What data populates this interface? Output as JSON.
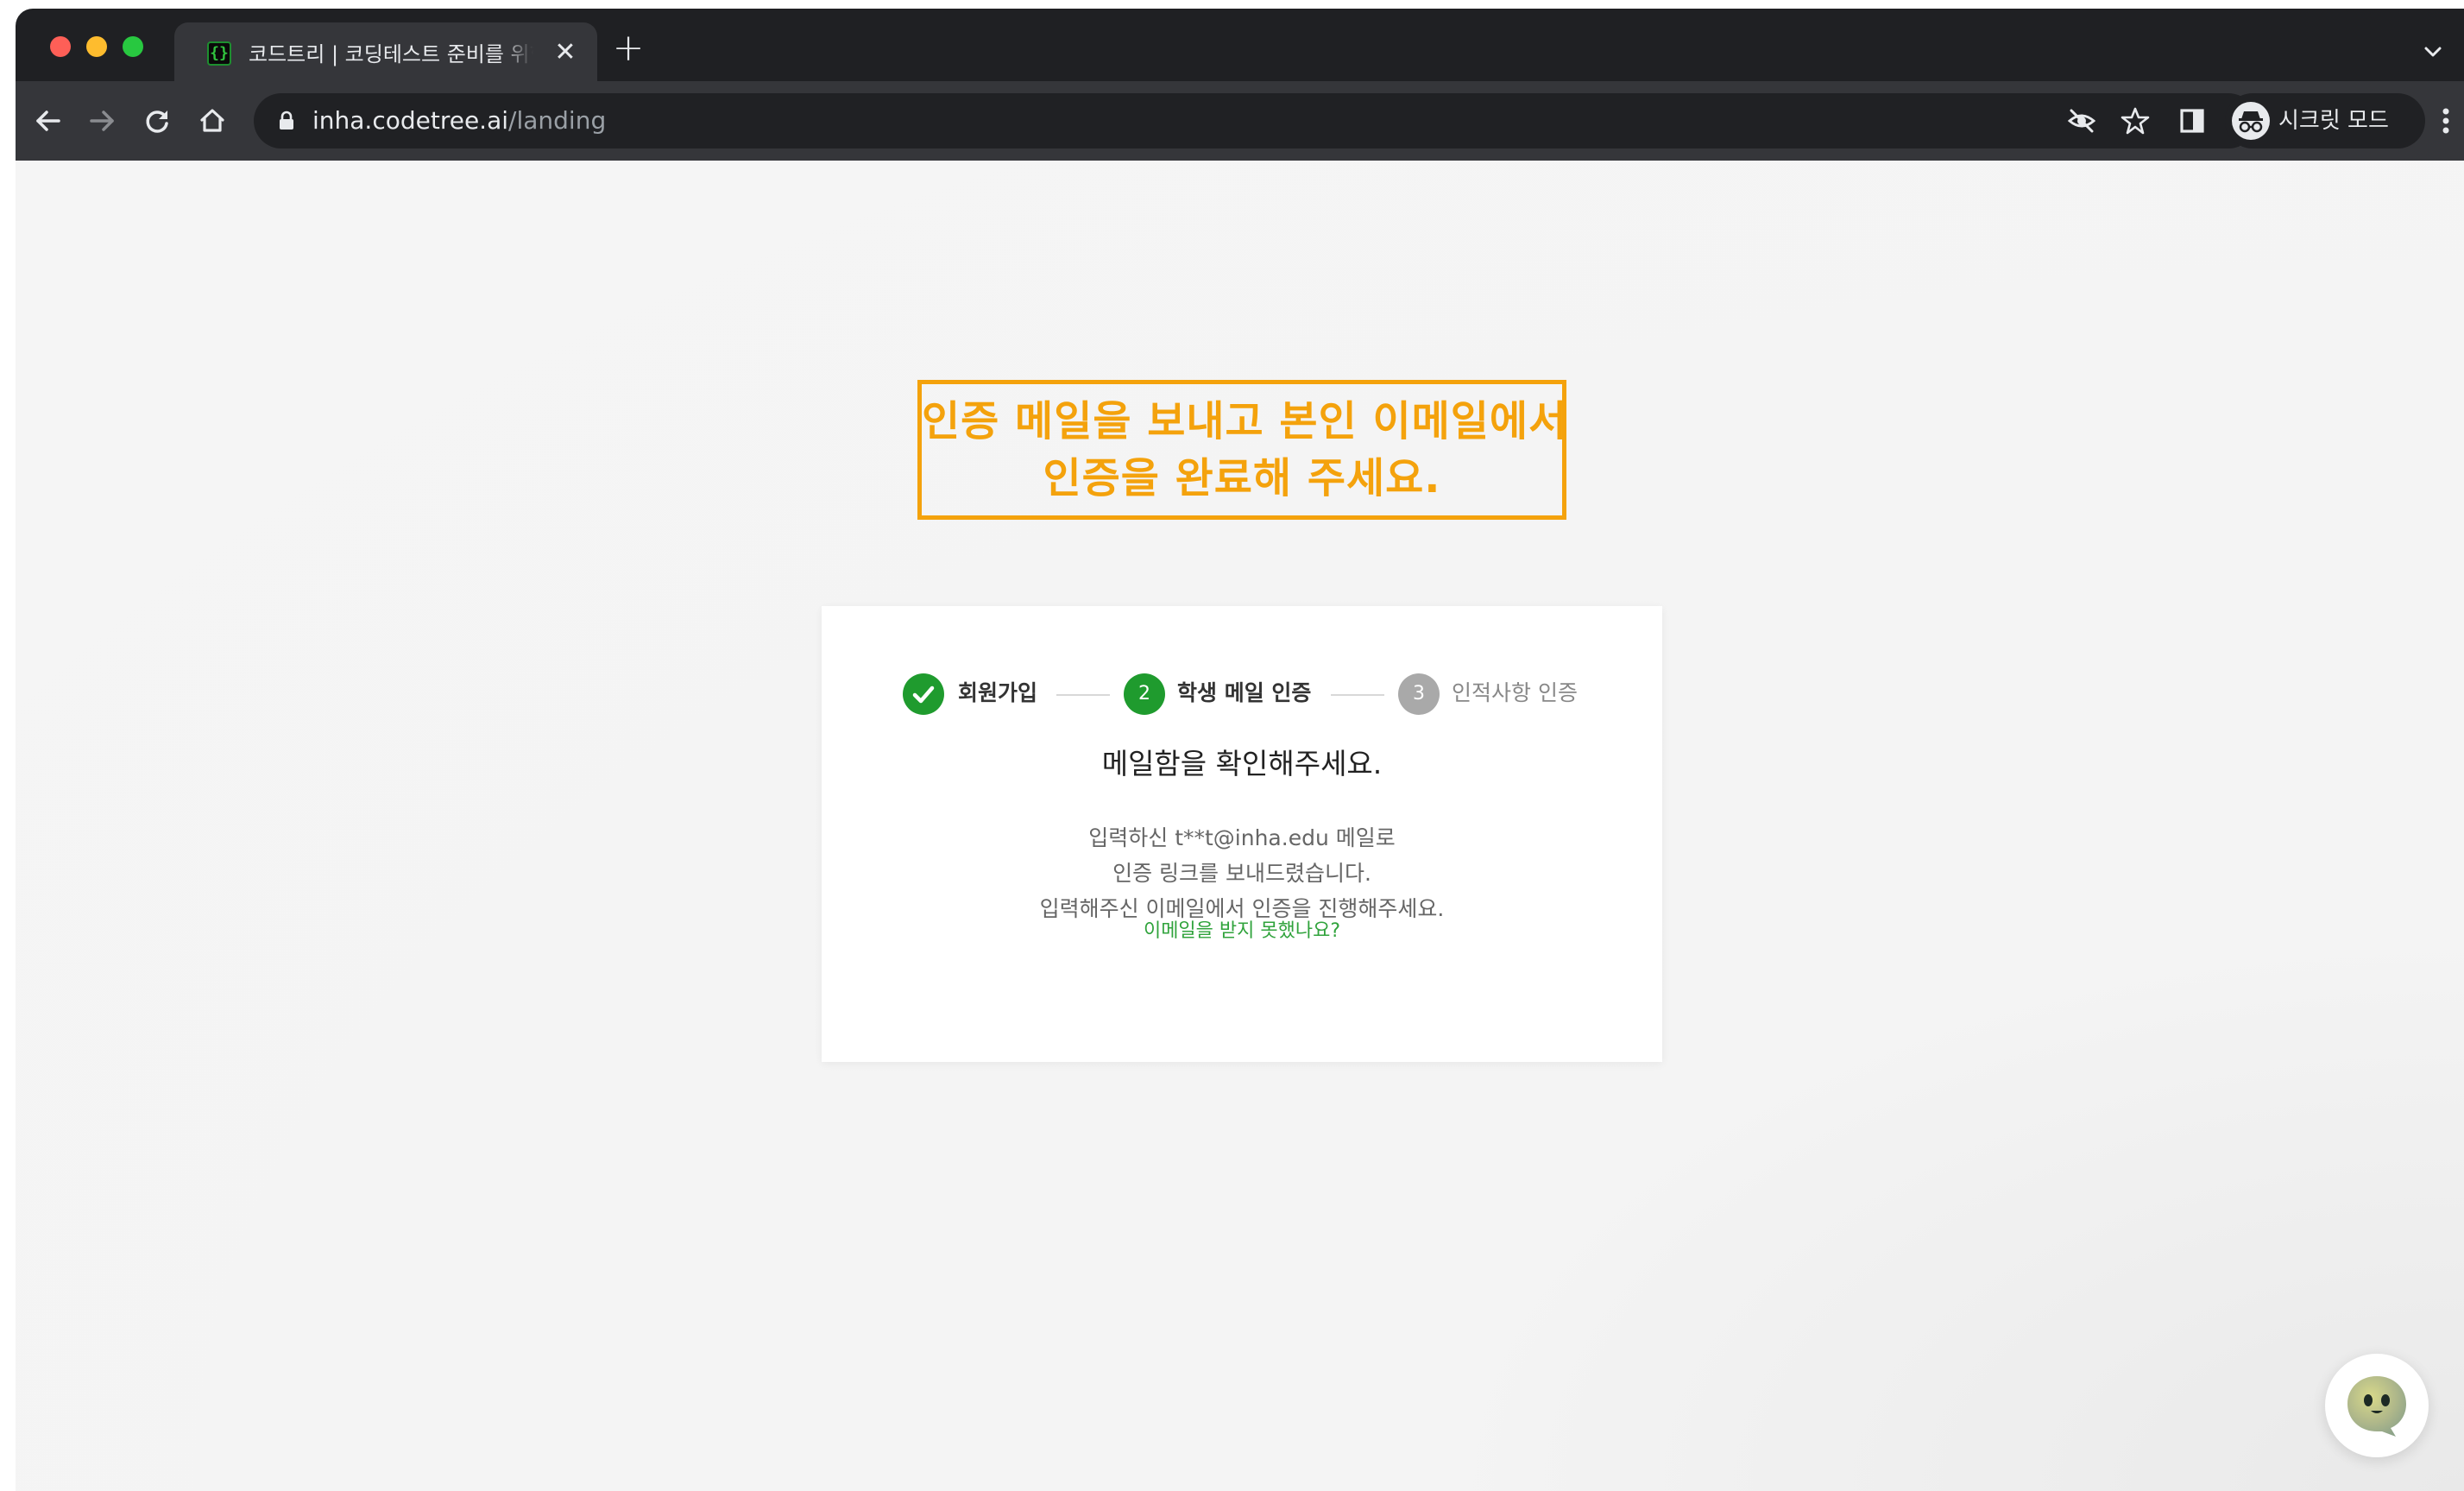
{
  "browser": {
    "tab_title": "코드트리 | 코딩테스트 준비를 위한 알고리즘",
    "tab_close": "✕",
    "new_tab": "+",
    "url_host": "inha.codetree.ai",
    "url_path": "/landing",
    "profile_label": "시크릿 모드"
  },
  "annotation": {
    "line1": "인증 메일을 보내고 본인 이메일에서",
    "line2": "인증을 완료해 주세요.",
    "color": "#f4a20c"
  },
  "stepper": {
    "steps": [
      {
        "label": "회원가입",
        "status": "done"
      },
      {
        "number": "2",
        "label": "학생 메일 인증",
        "status": "active"
      },
      {
        "number": "3",
        "label": "인적사항 인증",
        "status": "pending"
      }
    ]
  },
  "card": {
    "title": "메일함을 확인해주세요.",
    "body_line1": "입력하신 t**t@inha.edu 메일로",
    "body_line2": "인증 링크를 보내드렸습니다.",
    "body_line3": "입력해주신 이메일에서 인증을 진행해주세요.",
    "resend_link": "이메일을 받지 못했나요?"
  },
  "colors": {
    "step_done": "#1f9b2e",
    "step_active": "#1f9b2e",
    "step_pending": "#a9a9a9",
    "link": "#30a33c"
  },
  "icons": {
    "chat": "chat-bubble-face-icon"
  }
}
